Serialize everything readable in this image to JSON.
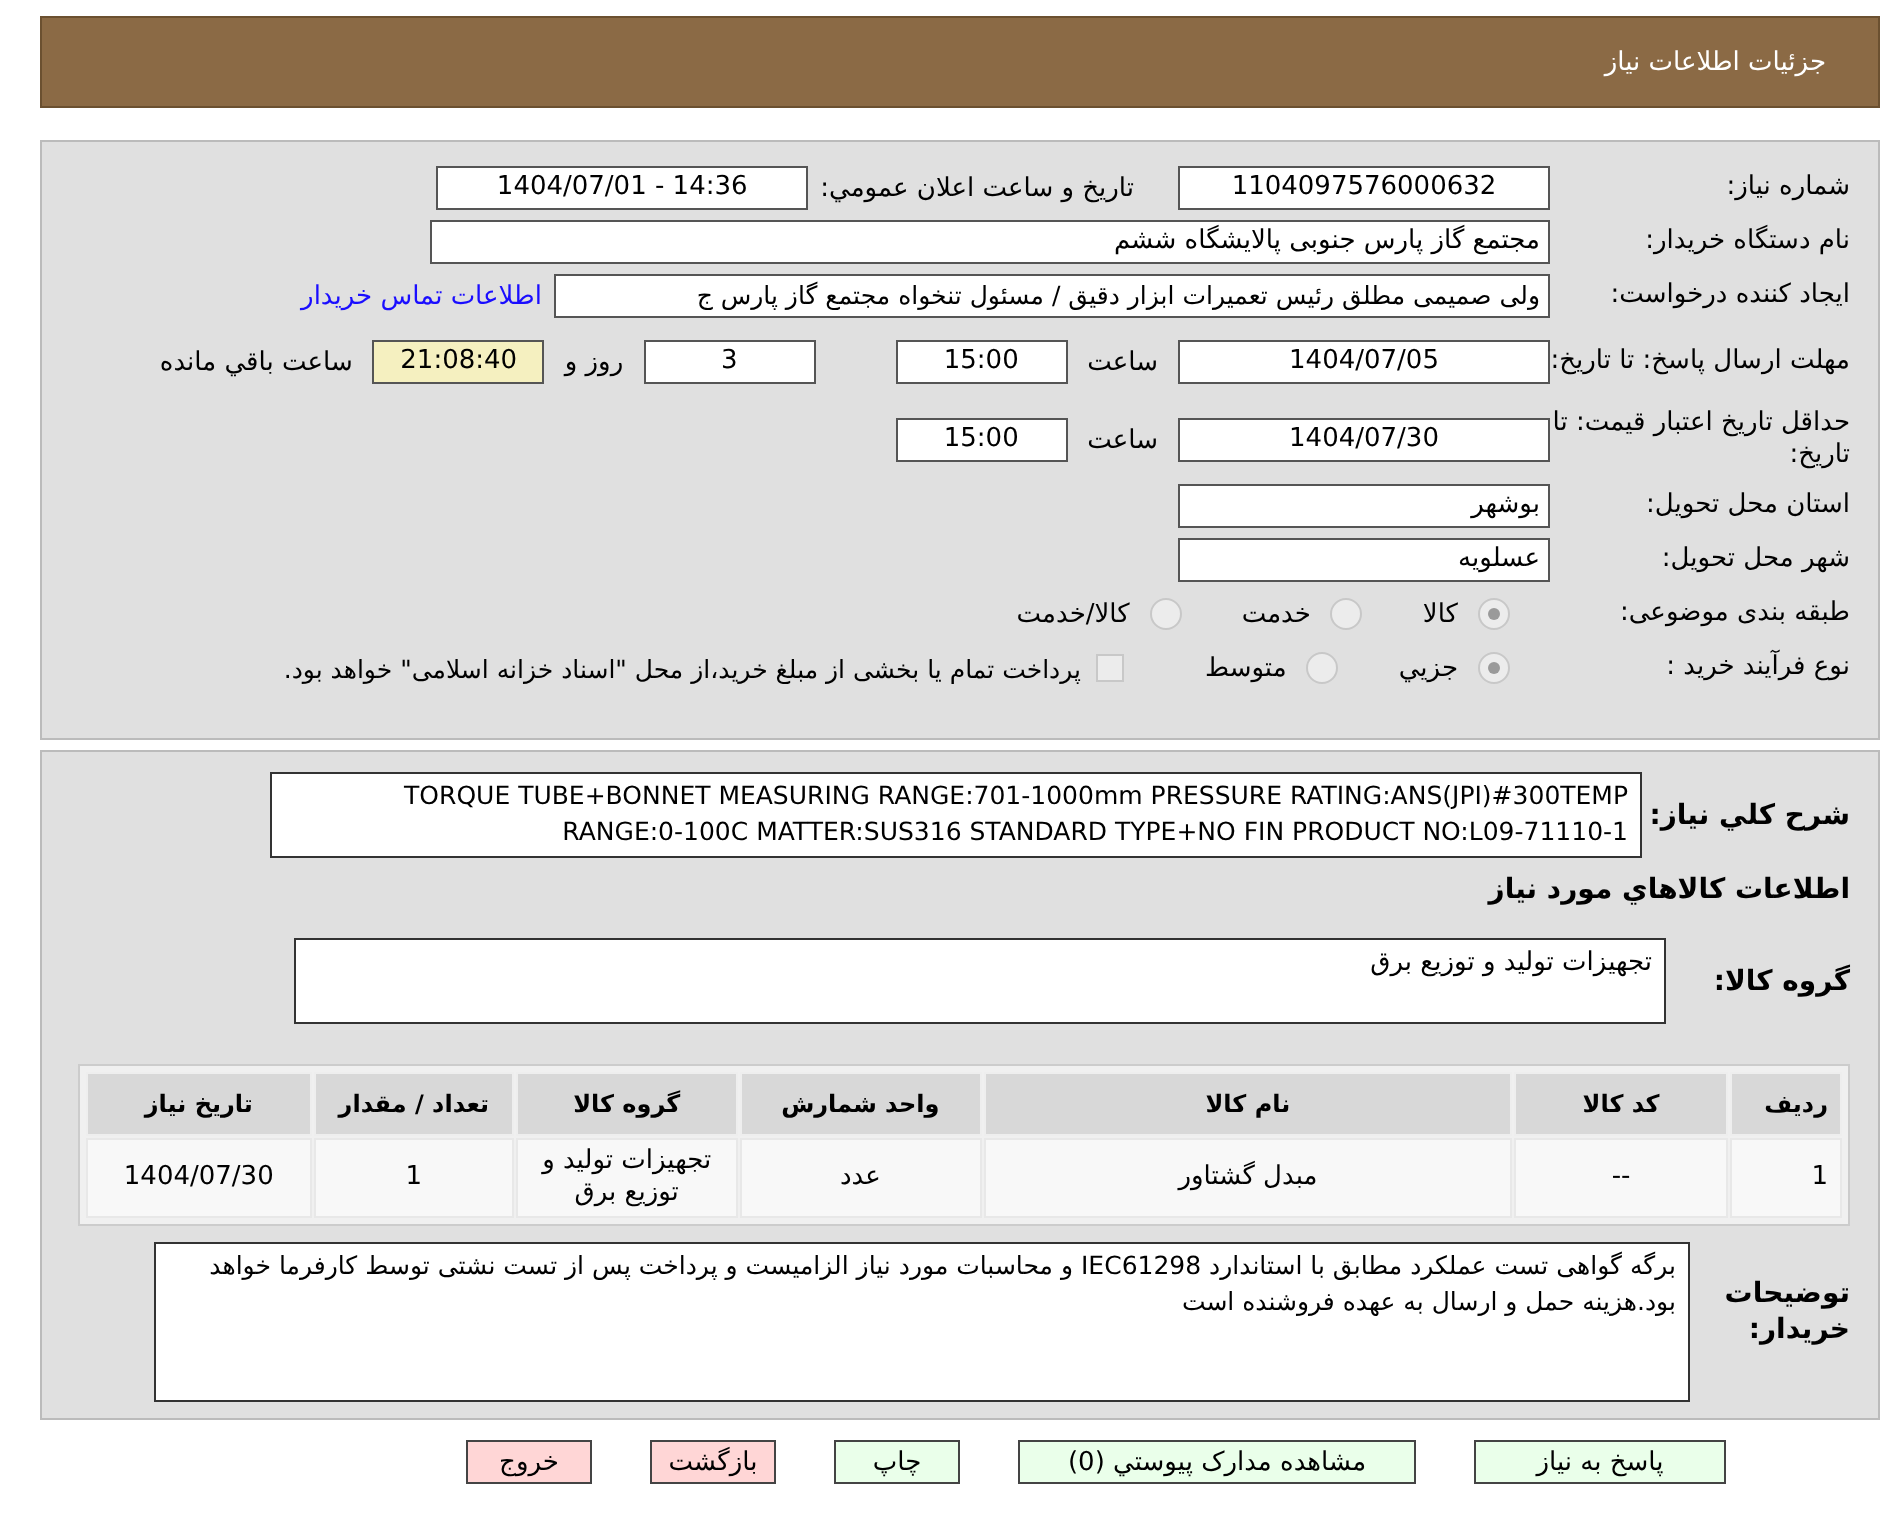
{
  "header": {
    "title": "جزئیات اطلاعات نیاز"
  },
  "need_number": {
    "label": "شماره نیاز:",
    "value": "1104097576000632"
  },
  "announce": {
    "label": "تاریخ و ساعت اعلان عمومي:",
    "value": "1404/07/01 - 14:36"
  },
  "buyer": {
    "label": "نام دستگاه خریدار:",
    "value": "مجتمع گاز پارس جنوبی  پالایشگاه ششم"
  },
  "creator": {
    "label": "ایجاد کننده درخواست:",
    "value": "ولی صمیمی مطلق رئیس تعمیرات ابزار دقیق / مسئول تنخواه مجتمع گاز پارس ج",
    "link": "اطلاعات تماس خریدار"
  },
  "deadline": {
    "label": "مهلت ارسال پاسخ: تا تاریخ:",
    "date": "1404/07/05",
    "time_label": "ساعت",
    "time": "15:00",
    "days": "3",
    "days_label": "روز و",
    "remaining": "21:08:40",
    "remaining_label": "ساعت باقي مانده"
  },
  "validity": {
    "label": "حداقل تاریخ اعتبار قیمت: تا تاریخ:",
    "date": "1404/07/30",
    "time_label": "ساعت",
    "time": "15:00"
  },
  "province": {
    "label": "استان محل تحویل:",
    "value": "بوشهر"
  },
  "city": {
    "label": "شهر محل تحویل:",
    "value": "عسلویه"
  },
  "category": {
    "label": "طبقه بندی موضوعی:",
    "options": [
      {
        "label": "کالا",
        "selected": true
      },
      {
        "label": "خدمت",
        "selected": false
      },
      {
        "label": "کالا/خدمت",
        "selected": false
      }
    ]
  },
  "purchase_type": {
    "label": "نوع فرآیند خرید :",
    "options": [
      {
        "label": "جزيي",
        "selected": true
      },
      {
        "label": "متوسط",
        "selected": false
      }
    ],
    "payment": {
      "checked": false,
      "label": "پرداخت تمام یا بخشی از مبلغ خرید،از محل \"اسناد خزانه اسلامی\" خواهد بود."
    }
  },
  "description": {
    "label": "شرح کلي نیاز:",
    "value": "TORQUE TUBE+BONNET MEASURING RANGE:701-1000mm PRESSURE RATING:ANS(JPI)#300TEMP RANGE:0-100C MATTER:SUS316 STANDARD TYPE+NO FIN PRODUCT NO:L09-71110-1"
  },
  "goods_title": "اطلاعات کالاهاي مورد نیاز",
  "goods_group": {
    "label": "گروه کالا:",
    "value": "تجهیزات تولید و توزیع برق"
  },
  "table": {
    "columns": [
      "ردیف",
      "کد کالا",
      "نام کالا",
      "واحد شمارش",
      "گروه کالا",
      "تعداد / مقدار",
      "تاریخ نیاز"
    ],
    "rows": [
      [
        "1",
        "--",
        "مبدل گشتاور",
        "عدد",
        "تجهیزات تولید و توزیع برق",
        "1",
        "1404/07/30"
      ]
    ]
  },
  "buyer_notes": {
    "label": "توضیحات خریدار:",
    "value": "برگه گواهی تست عملکرد مطابق با استاندارد IEC61298 و محاسبات مورد نیاز الزامیست و پرداخت پس از تست نشتی توسط کارفرما خواهد بود.هزینه حمل و ارسال به عهده فروشنده است"
  },
  "buttons": [
    {
      "label": "پاسخ به نیاز",
      "kind": "primary"
    },
    {
      "label": "مشاهده مدارک پیوستي (0)",
      "kind": "primary"
    },
    {
      "label": "چاپ",
      "kind": "primary"
    },
    {
      "label": "بازگشت",
      "kind": "danger"
    },
    {
      "label": "خروج",
      "kind": "danger"
    }
  ]
}
